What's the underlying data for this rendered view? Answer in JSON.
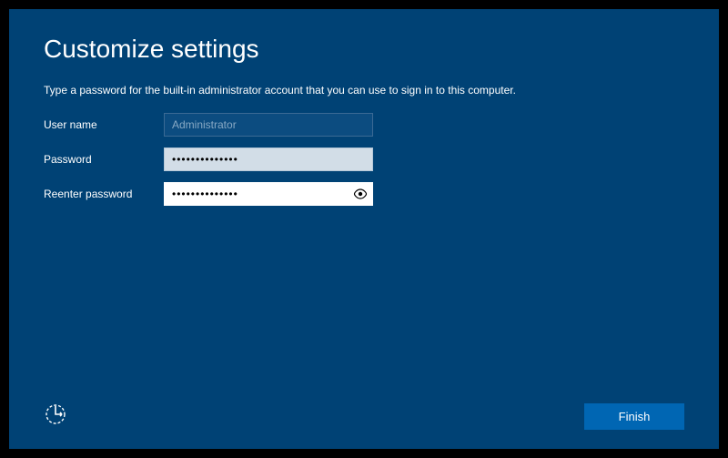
{
  "title": "Customize settings",
  "instruction": "Type a password for the built-in administrator account that you can use to sign in to this computer.",
  "fields": {
    "username_label": "User name",
    "username_placeholder": "Administrator",
    "username_value": "",
    "password_label": "Password",
    "password_value": "••••••••••••••",
    "reenter_label": "Reenter password",
    "reenter_value": "••••••••••••••"
  },
  "icons": {
    "reveal": "eye-icon",
    "accessibility": "accessibility-icon"
  },
  "buttons": {
    "finish": "Finish"
  },
  "colors": {
    "background": "#004275",
    "button": "#0066b3"
  }
}
